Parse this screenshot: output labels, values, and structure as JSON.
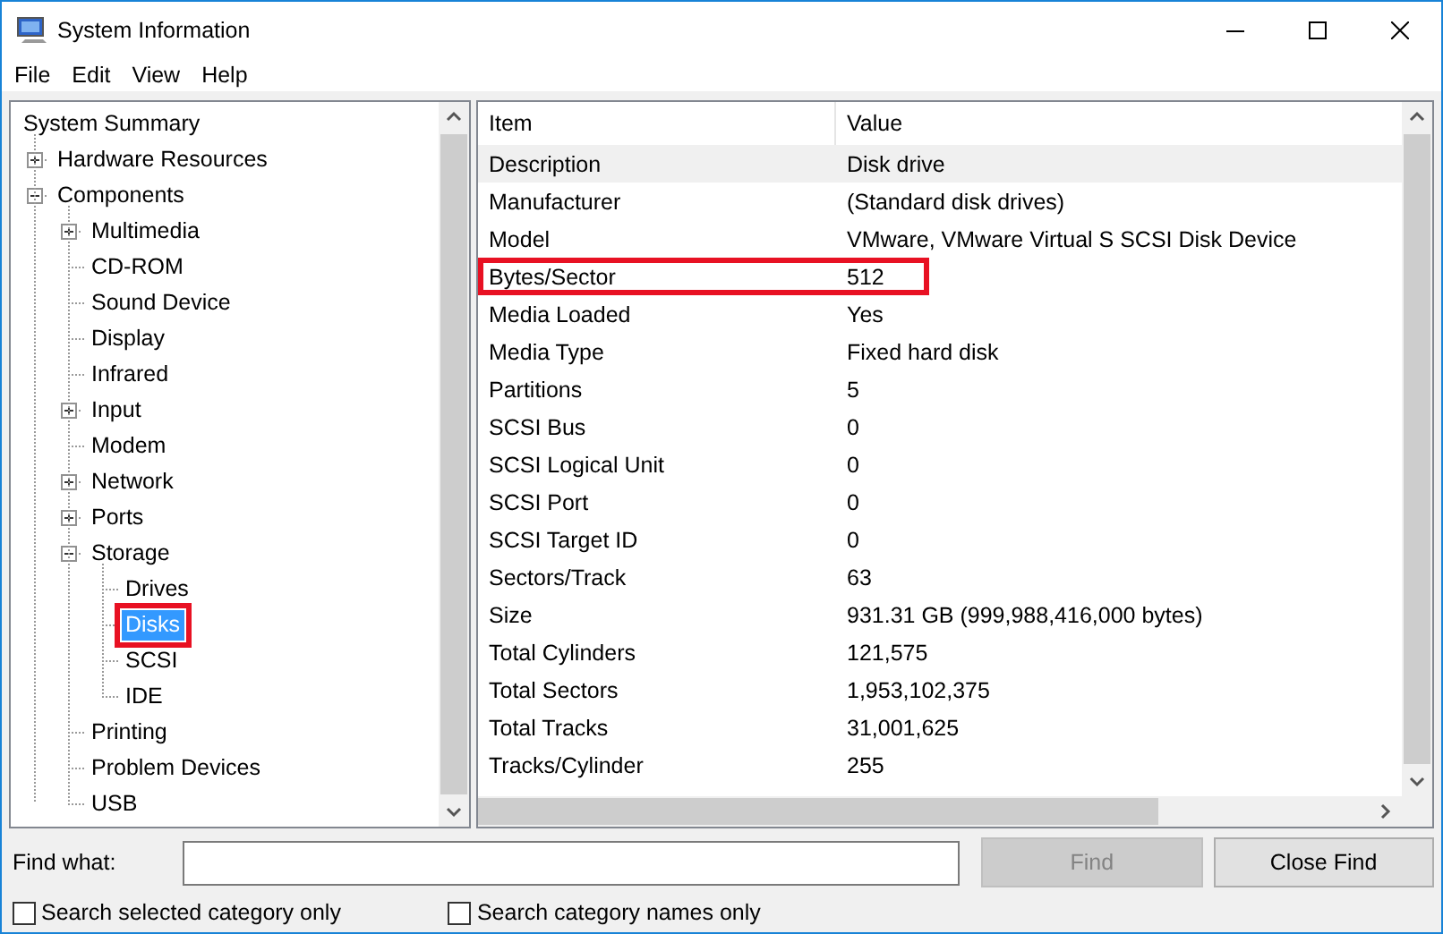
{
  "window": {
    "title": "System Information"
  },
  "menu": [
    "File",
    "Edit",
    "View",
    "Help"
  ],
  "tree": {
    "items": [
      {
        "label": "System Summary",
        "selected": false,
        "highlighted": false,
        "children": [
          {
            "label": "Hardware Resources",
            "expanded": false,
            "selected": false,
            "highlighted": false
          },
          {
            "label": "Components",
            "expanded": true,
            "selected": false,
            "highlighted": false,
            "children": [
              {
                "label": "Multimedia",
                "expanded": false,
                "selected": false,
                "highlighted": false
              },
              {
                "label": "CD-ROM",
                "selected": false,
                "highlighted": false
              },
              {
                "label": "Sound Device",
                "selected": false,
                "highlighted": false
              },
              {
                "label": "Display",
                "selected": false,
                "highlighted": false
              },
              {
                "label": "Infrared",
                "selected": false,
                "highlighted": false
              },
              {
                "label": "Input",
                "expanded": false,
                "selected": false,
                "highlighted": false
              },
              {
                "label": "Modem",
                "selected": false,
                "highlighted": false
              },
              {
                "label": "Network",
                "expanded": false,
                "selected": false,
                "highlighted": false
              },
              {
                "label": "Ports",
                "expanded": false,
                "selected": false,
                "highlighted": false
              },
              {
                "label": "Storage",
                "expanded": true,
                "selected": false,
                "highlighted": false,
                "children": [
                  {
                    "label": "Drives",
                    "selected": false,
                    "highlighted": false
                  },
                  {
                    "label": "Disks",
                    "selected": true,
                    "highlighted": true
                  },
                  {
                    "label": "SCSI",
                    "selected": false,
                    "highlighted": false
                  },
                  {
                    "label": "IDE",
                    "selected": false,
                    "highlighted": false
                  }
                ]
              },
              {
                "label": "Printing",
                "selected": false,
                "highlighted": false
              },
              {
                "label": "Problem Devices",
                "selected": false,
                "highlighted": false
              },
              {
                "label": "USB",
                "selected": false,
                "highlighted": false
              }
            ]
          }
        ]
      }
    ]
  },
  "table": {
    "columns": [
      "Item",
      "Value"
    ],
    "rows": [
      {
        "item": "Description",
        "value": "Disk drive",
        "selected": true,
        "highlighted": false
      },
      {
        "item": "Manufacturer",
        "value": "(Standard disk drives)",
        "selected": false,
        "highlighted": false
      },
      {
        "item": "Model",
        "value": "VMware, VMware Virtual S SCSI Disk Device",
        "selected": false,
        "highlighted": false
      },
      {
        "item": "Bytes/Sector",
        "value": "512",
        "selected": false,
        "highlighted": true
      },
      {
        "item": "Media Loaded",
        "value": "Yes",
        "selected": false,
        "highlighted": false
      },
      {
        "item": "Media Type",
        "value": "Fixed hard disk",
        "selected": false,
        "highlighted": false
      },
      {
        "item": "Partitions",
        "value": "5",
        "selected": false,
        "highlighted": false
      },
      {
        "item": "SCSI Bus",
        "value": "0",
        "selected": false,
        "highlighted": false
      },
      {
        "item": "SCSI Logical Unit",
        "value": "0",
        "selected": false,
        "highlighted": false
      },
      {
        "item": "SCSI Port",
        "value": "0",
        "selected": false,
        "highlighted": false
      },
      {
        "item": "SCSI Target ID",
        "value": "0",
        "selected": false,
        "highlighted": false
      },
      {
        "item": "Sectors/Track",
        "value": "63",
        "selected": false,
        "highlighted": false
      },
      {
        "item": "Size",
        "value": "931.31 GB (999,988,416,000 bytes)",
        "selected": false,
        "highlighted": false
      },
      {
        "item": "Total Cylinders",
        "value": "121,575",
        "selected": false,
        "highlighted": false
      },
      {
        "item": "Total Sectors",
        "value": "1,953,102,375",
        "selected": false,
        "highlighted": false
      },
      {
        "item": "Total Tracks",
        "value": "31,001,625",
        "selected": false,
        "highlighted": false
      },
      {
        "item": "Tracks/Cylinder",
        "value": "255",
        "selected": false,
        "highlighted": false
      }
    ]
  },
  "find": {
    "label": "Find what:",
    "find_button": {
      "label": "Find",
      "disabled": true
    },
    "close_button": {
      "label": "Close Find",
      "disabled": false
    }
  },
  "options": [
    {
      "label": "Search selected category only",
      "checked": false
    },
    {
      "label": "Search category names only",
      "checked": false
    }
  ]
}
